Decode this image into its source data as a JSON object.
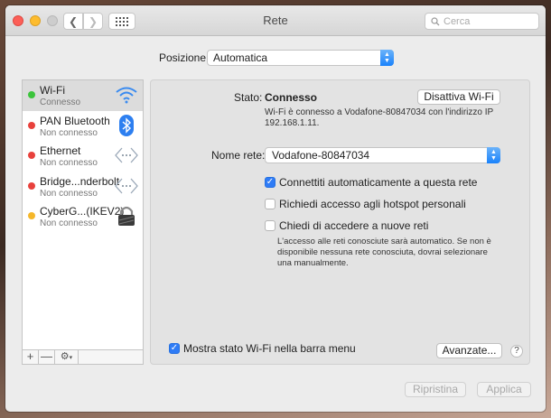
{
  "window": {
    "title": "Rete",
    "search_placeholder": "Cerca"
  },
  "location": {
    "label": "Posizione:",
    "value": "Automatica"
  },
  "services": [
    {
      "name": "Wi-Fi",
      "status": "Connesso",
      "dot_color": "#3cc43c",
      "icon": "wifi-icon",
      "selected": true
    },
    {
      "name": "PAN Bluetooth",
      "status": "Non connesso",
      "dot_color": "#e8413c",
      "icon": "bluetooth-icon"
    },
    {
      "name": "Ethernet",
      "status": "Non connesso",
      "dot_color": "#e8413c",
      "icon": "ethernet-icon"
    },
    {
      "name": "Bridge...nderbolt",
      "status": "Non connesso",
      "dot_color": "#e8413c",
      "icon": "thunderbolt-bridge-icon"
    },
    {
      "name": "CyberG...(IKEV2)",
      "status": "Non connesso",
      "dot_color": "#f5b72a",
      "icon": "vpn-lock-icon"
    }
  ],
  "sidebar_tools": {
    "add": "+",
    "remove": "—",
    "gear": "⚙"
  },
  "detail": {
    "status_label": "Stato:",
    "status_value": "Connesso",
    "toggle_wifi_button": "Disattiva Wi-Fi",
    "status_description": "Wi-Fi è connesso a Vodafone-80847034 con l'indirizzo IP 192.168.1.11.",
    "network_label": "Nome rete:",
    "network_value": "Vodafone-80847034",
    "options": [
      {
        "label": "Connettiti automaticamente a questa rete",
        "checked": true
      },
      {
        "label": "Richiedi accesso agli hotspot personali",
        "checked": false
      },
      {
        "label": "Chiedi di accedere a nuove reti",
        "checked": false
      }
    ],
    "options_note": "L'accesso alle reti conosciute sarà automatico. Se non è disponibile nessuna rete conosciuta, dovrai selezionare una manualmente.",
    "show_menu_bar": {
      "label": "Mostra stato Wi-Fi nella barra menu",
      "checked": true
    },
    "advanced_button": "Avanzate...",
    "help": "?"
  },
  "footer": {
    "revert_button": "Ripristina",
    "apply_button": "Applica"
  },
  "colors": {
    "accent": "#2f7cf6",
    "selected_row": "#dcdcdc"
  }
}
